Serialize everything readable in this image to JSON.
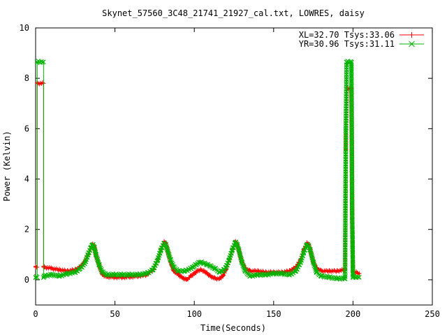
{
  "chart_data": {
    "type": "line",
    "title": "Skynet_57560_3C48_21741_21927_cal.txt, LOWRES, daisy",
    "xlabel": "Time(Seconds)",
    "ylabel": "Power (Kelvin)",
    "xlim": [
      0,
      250
    ],
    "ylim": [
      -1,
      10
    ],
    "xticks": [
      0,
      50,
      100,
      150,
      200,
      250
    ],
    "yticks": [
      0,
      2,
      4,
      6,
      8,
      10
    ],
    "grid": false,
    "legend_position": "top-right",
    "series": [
      {
        "name": "XL=32.70 Tsys:33.06",
        "color": "#ff0000",
        "marker": "plus",
        "x": [
          0,
          1,
          1,
          5,
          5,
          5.5,
          10,
          15,
          20,
          25,
          28,
          31,
          33,
          35,
          36,
          37,
          38,
          40,
          42,
          45,
          50,
          55,
          60,
          65,
          70,
          74,
          77,
          79,
          81,
          82,
          83,
          85,
          87,
          90,
          92,
          95,
          98,
          100,
          102,
          104,
          106,
          108,
          110,
          113,
          116,
          118,
          120,
          122,
          124,
          126,
          127,
          128,
          130,
          132,
          135,
          140,
          145,
          150,
          155,
          160,
          164,
          167,
          169,
          171,
          172,
          173,
          175,
          177,
          180,
          185,
          190,
          195,
          195.5,
          196,
          199,
          199.5,
          200,
          202,
          204
        ],
        "y": [
          0.5,
          0.5,
          7.8,
          7.8,
          0.5,
          0.5,
          0.45,
          0.4,
          0.35,
          0.4,
          0.5,
          0.7,
          1.0,
          1.3,
          1.4,
          1.3,
          1.0,
          0.6,
          0.2,
          0.12,
          0.1,
          0.1,
          0.12,
          0.15,
          0.2,
          0.4,
          0.8,
          1.2,
          1.5,
          1.45,
          1.2,
          0.7,
          0.35,
          0.2,
          0.1,
          0.0,
          0.15,
          0.25,
          0.35,
          0.4,
          0.35,
          0.25,
          0.15,
          0.05,
          0.05,
          0.15,
          0.4,
          0.8,
          1.2,
          1.5,
          1.4,
          1.2,
          0.7,
          0.45,
          0.35,
          0.35,
          0.3,
          0.3,
          0.3,
          0.35,
          0.5,
          0.8,
          1.2,
          1.45,
          1.4,
          1.2,
          0.7,
          0.45,
          0.35,
          0.35,
          0.35,
          0.4,
          5.15,
          7.6,
          7.6,
          2.4,
          0.3,
          0.3,
          0.25
        ]
      },
      {
        "name": "YR=30.96 Tsys:31.11",
        "color": "#00b400",
        "marker": "cross",
        "x": [
          0,
          1,
          1,
          5,
          5,
          5.5,
          10,
          15,
          20,
          25,
          28,
          31,
          33,
          35,
          36,
          37,
          38,
          40,
          42,
          45,
          50,
          55,
          60,
          65,
          70,
          74,
          77,
          79,
          81,
          82,
          83,
          85,
          87,
          90,
          94,
          98,
          100,
          102,
          104,
          106,
          108,
          110,
          113,
          116,
          118,
          120,
          122,
          124,
          126,
          127,
          128,
          130,
          132,
          135,
          140,
          145,
          150,
          155,
          160,
          164,
          167,
          169,
          171,
          172,
          173,
          175,
          177,
          180,
          185,
          190,
          195,
          195.5,
          196,
          199,
          199.5,
          200,
          202,
          204
        ],
        "y": [
          0.1,
          0.1,
          8.65,
          8.65,
          0.1,
          0.15,
          0.2,
          0.15,
          0.25,
          0.3,
          0.45,
          0.65,
          1.0,
          1.3,
          1.4,
          1.3,
          1.0,
          0.6,
          0.3,
          0.2,
          0.2,
          0.2,
          0.2,
          0.2,
          0.25,
          0.4,
          0.8,
          1.2,
          1.45,
          1.4,
          1.2,
          0.8,
          0.5,
          0.35,
          0.35,
          0.45,
          0.55,
          0.65,
          0.7,
          0.65,
          0.6,
          0.55,
          0.45,
          0.3,
          0.35,
          0.5,
          0.8,
          1.2,
          1.5,
          1.4,
          1.2,
          0.7,
          0.35,
          0.15,
          0.2,
          0.2,
          0.25,
          0.25,
          0.2,
          0.35,
          0.7,
          1.1,
          1.4,
          1.35,
          1.2,
          0.7,
          0.3,
          0.15,
          0.1,
          0.05,
          0.05,
          5.95,
          8.65,
          8.65,
          2.55,
          0.1,
          0.1,
          0.1
        ]
      }
    ]
  }
}
